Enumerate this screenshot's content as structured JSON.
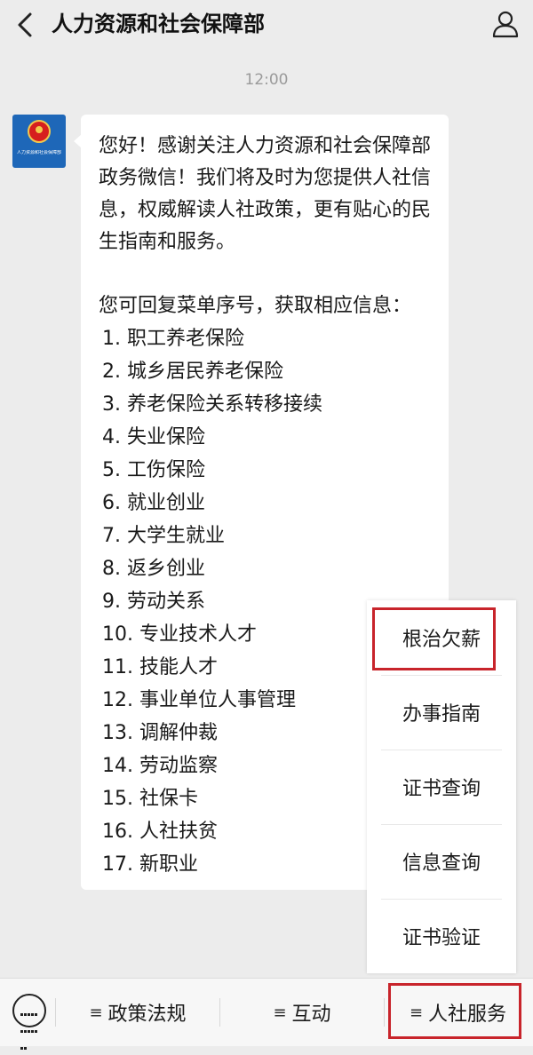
{
  "header": {
    "back_icon": "chevron-left-icon",
    "title": "人力资源和社会保障部",
    "profile_icon": "person-icon"
  },
  "chat": {
    "time": "12:00",
    "avatar_text": "人力资源和社会保障部",
    "intro": "您好！感谢关注人力资源和社会保障部政务微信！我们将及时为您提供人社信息，权威解读人社政策，更有贴心的民生指南和服务。",
    "prompt": "您可回复菜单序号，获取相应信息：",
    "items": [
      "1. 职工养老保险",
      "2. 城乡居民养老保险",
      "3. 养老保险关系转移接续",
      "4. 失业保险",
      "5. 工伤保险",
      "6. 就业创业",
      "7. 大学生就业",
      "8. 返乡创业",
      "9. 劳动关系",
      "10. 专业技术人才",
      "11. 技能人才",
      "12. 事业单位人事管理",
      "13. 调解仲裁",
      "14. 劳动监察",
      "15. 社保卡",
      "16. 人社扶贫",
      "17. 新职业"
    ]
  },
  "popup_menu": {
    "items": [
      "根治欠薪",
      "办事指南",
      "证书查询",
      "信息查询",
      "证书验证"
    ]
  },
  "bottom_bar": {
    "keyboard_icon": "keyboard-icon",
    "menu_glyph": "≡",
    "tabs": [
      "政策法规",
      "互动",
      "人社服务"
    ]
  },
  "colors": {
    "highlight": "#c8242b",
    "background": "#ececec",
    "bubble": "#ffffff"
  }
}
